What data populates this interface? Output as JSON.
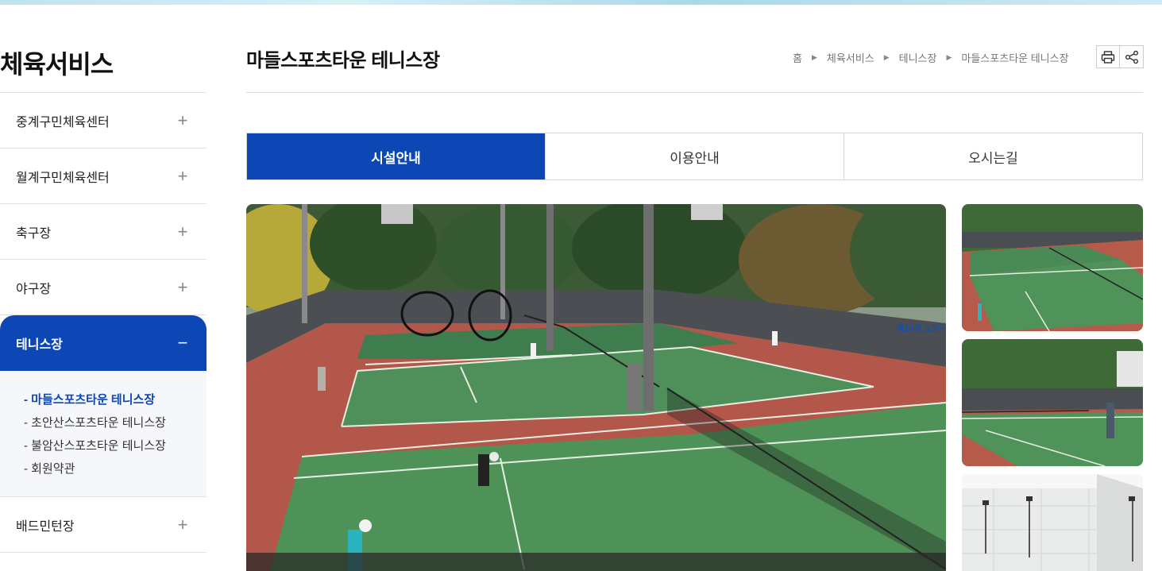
{
  "sidebar": {
    "title": "체육서비스",
    "items": [
      {
        "label": "중계구민체육센터",
        "icon": "plus-icon",
        "symbol": "+"
      },
      {
        "label": "월계구민체육센터",
        "icon": "plus-icon",
        "symbol": "+"
      },
      {
        "label": "축구장",
        "icon": "plus-icon",
        "symbol": "+"
      },
      {
        "label": "야구장",
        "icon": "plus-icon",
        "symbol": "+"
      },
      {
        "label": "테니스장",
        "icon": "minus-icon",
        "symbol": "−"
      },
      {
        "label": "배드민턴장",
        "icon": "plus-icon",
        "symbol": "+"
      }
    ],
    "submenu": [
      "- 마들스포츠타운 테니스장",
      "- 초안산스포츠타운 테니스장",
      "- 불암산스포츠타운 테니스장",
      "- 회원약관"
    ]
  },
  "header": {
    "title": "마들스포츠타운 테니스장",
    "breadcrumb": [
      "홈",
      "체육서비스",
      "테니스장",
      "마들스포츠타운 테니스장"
    ]
  },
  "tools": {
    "print_icon": "print-icon",
    "share_icon": "share-icon"
  },
  "tabs": [
    "시설안내",
    "이용안내",
    "오시는길"
  ],
  "gallery": {
    "main_banner_text": "제26회 노원구",
    "accent_color": "#0d47b5"
  }
}
